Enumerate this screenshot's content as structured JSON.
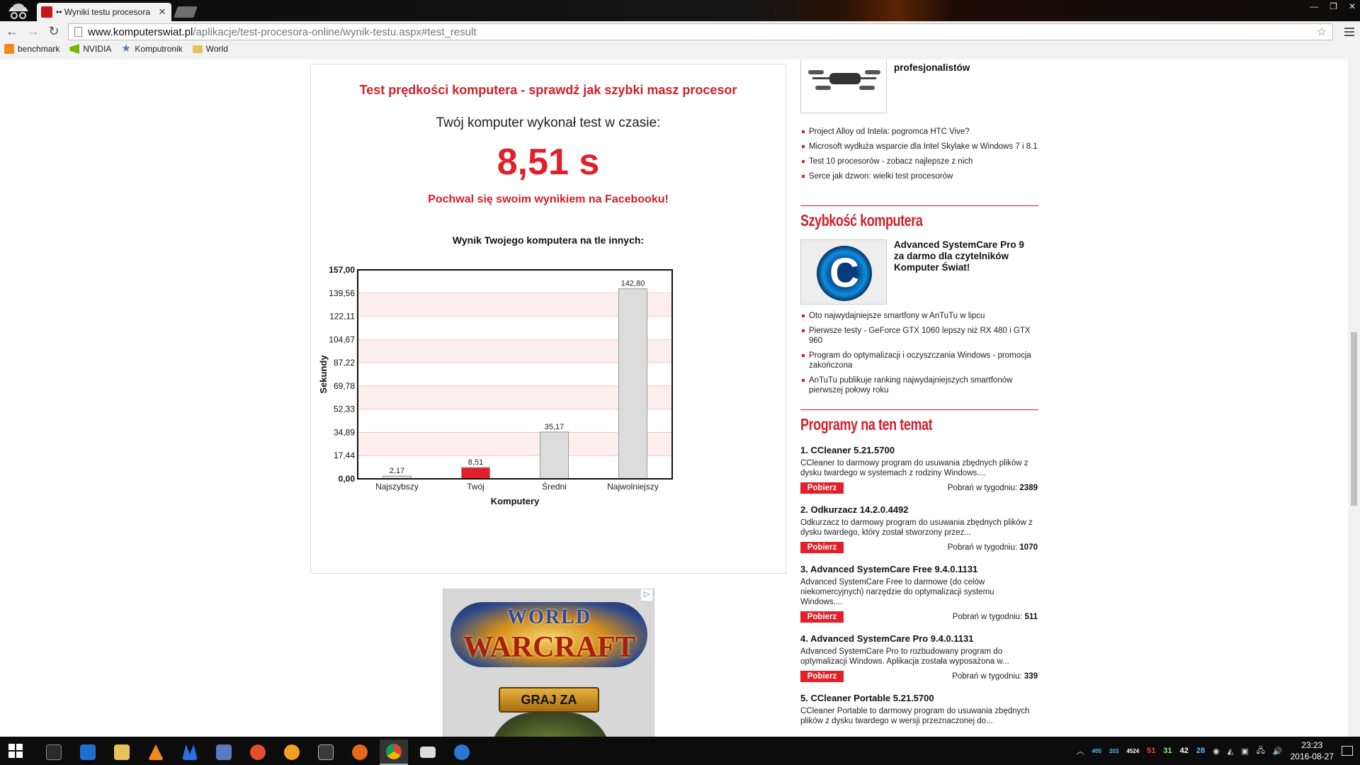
{
  "browser": {
    "tab_title": "•• Wyniki testu procesora",
    "url_host": "www.komputerswiat.pl",
    "url_path": "/aplikacje/test-procesora-online/wynik-testu.aspx#test_result",
    "bookmarks": [
      {
        "label": "benchmark",
        "icon": "bookmark-site-icon"
      },
      {
        "label": "NVIDIA",
        "icon": "nvidia-icon"
      },
      {
        "label": "Komputronik",
        "icon": "star-icon"
      },
      {
        "label": "World",
        "icon": "folder-icon"
      }
    ]
  },
  "result": {
    "title": "Test prędkości komputera - sprawdź jak szybki masz procesor",
    "subtitle": "Twój komputer wykonał test w czasie:",
    "time": "8,51 s",
    "share": "Pochwal się swoim wynikiem na Facebooku!",
    "chart_heading": "Wynik Twojego komputera na tle innych:"
  },
  "chart_data": {
    "type": "bar",
    "categories": [
      "Najszybszy",
      "Twój",
      "Średni",
      "Najwolniejszy"
    ],
    "values": [
      2.17,
      8.51,
      35.17,
      142.8
    ],
    "value_labels": [
      "2,17",
      "8,51",
      "35,17",
      "142,80"
    ],
    "highlight_index": 1,
    "colors": [
      "#dcdcdc",
      "#e2202a",
      "#dcdcdc",
      "#dcdcdc"
    ],
    "highlight_color": "#e2202a",
    "band_color": "#fdeeee",
    "ylim": [
      0,
      157
    ],
    "yticks": [
      "0,00",
      "17,44",
      "34,89",
      "52,33",
      "69,78",
      "87,22",
      "104,67",
      "122,11",
      "139,56",
      "157,00"
    ],
    "ylabel": "Sekundy",
    "xlabel": "Komputery",
    "grid": true
  },
  "ad": {
    "world": "WORLD",
    "warcraft": "WARCRAFT",
    "button": "GRAJ ZA DARMO"
  },
  "sidebar": {
    "top_article_title": "Aero – dron Intela dla profesjonalistów",
    "list1": [
      "Project Alloy od Intela: pogromca HTC Vive?",
      "Microsoft wydłuża wsparcie dla Intel Skylake w Windows 7 i 8.1",
      "Test 10 procesorów - zobacz najlepsze z nich",
      "Serce jak dzwon: wielki test procesorów"
    ],
    "speed_heading": "Szybkość komputera",
    "speed_article_title": "Advanced SystemCare Pro 9 za darmo dla czytelników Komputer Świat!",
    "list2": [
      "Oto najwydajniejsze smartfony w AnTuTu w lipcu",
      "Pierwsze testy - GeForce GTX 1060 lepszy niż RX 480 i GTX 960",
      "Program do optymalizacji i oczyszczania Windows - promocja zakończona",
      "AnTuTu publikuje ranking najwydajniejszych smartfonów pierwszej połowy roku"
    ],
    "programs_heading": "Programy na ten temat",
    "download_label": "Pobierz",
    "downloads_prefix": "Pobrań w tygodniu:",
    "programs": [
      {
        "title": "1. CCleaner 5.21.5700",
        "desc": "CCleaner to darmowy program do usuwania zbędnych plików z dysku twardego w systemach z rodziny Windows....",
        "count": "2389"
      },
      {
        "title": "2. Odkurzacz 14.2.0.4492",
        "desc": "Odkurzacz to darmowy program do usuwania zbędnych plików z dysku twardego, który został stworzony przez...",
        "count": "1070"
      },
      {
        "title": "3. Advanced SystemCare Free 9.4.0.1131",
        "desc": "Advanced SystemCare Free to darmowe (do celów niekomercyjnych) narzędzie do optymalizacji systemu Windows....",
        "count": "511"
      },
      {
        "title": "4. Advanced SystemCare Pro 9.4.0.1131",
        "desc": "Advanced SystemCare Pro to rozbudowany program do optymalizacji Windows. Aplikacja została wyposażona w...",
        "count": "339"
      },
      {
        "title": "5. CCleaner Portable 5.21.5700",
        "desc": "CCleaner Portable to darmowy program do usuwania zbędnych plików z dysku twardego w wersji przeznaczonej do..."
      }
    ]
  },
  "taskbar": {
    "tray_values": [
      "405",
      "203",
      "4524",
      "51",
      "31",
      "42",
      "28"
    ],
    "tray_colors": [
      "#4fc3f7",
      "#4fc3f7",
      "#ffffff",
      "#ff4040",
      "#7dff5a",
      "#ffffff",
      "#4fc3f7"
    ],
    "time": "23:23",
    "date": "2016-08-27"
  }
}
